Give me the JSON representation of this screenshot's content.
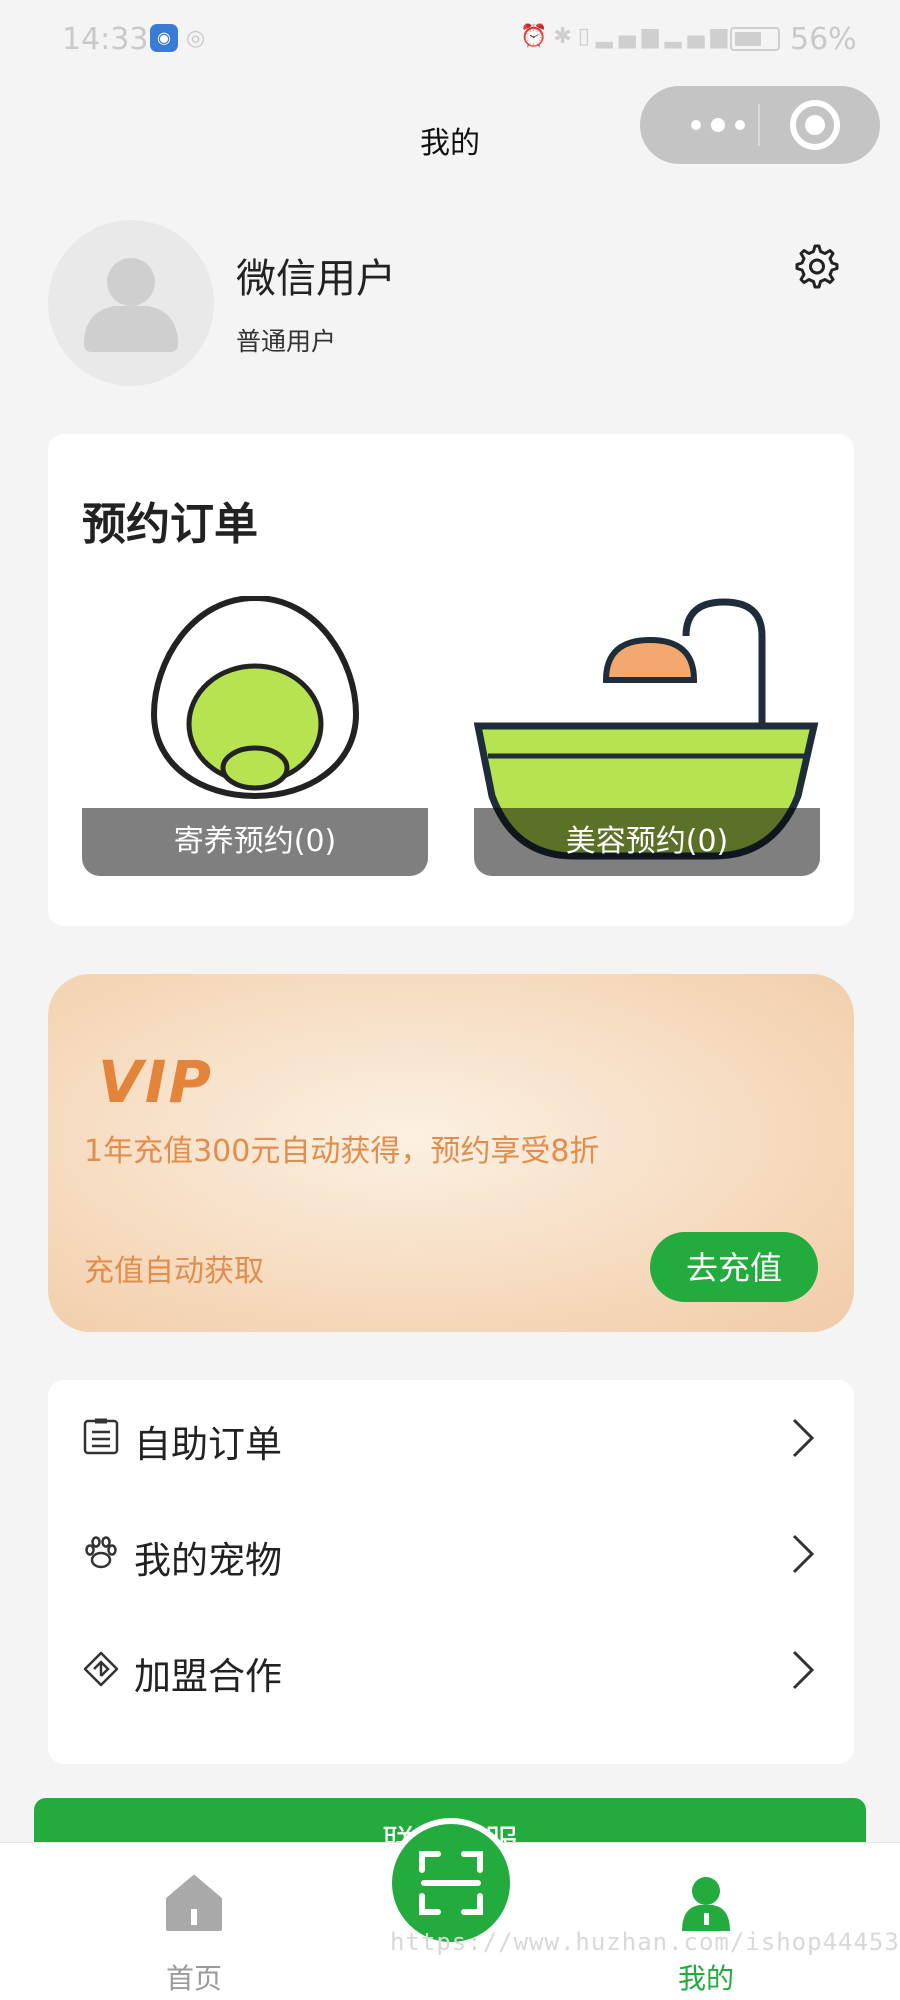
{
  "status_bar": {
    "time": "14:33",
    "battery": "56%"
  },
  "header": {
    "title": "我的"
  },
  "profile": {
    "name": "微信用户",
    "level": "普通用户"
  },
  "appointments": {
    "title": "预约订单",
    "items": [
      {
        "label": "寄养预约(0)",
        "icon": "egg-icon"
      },
      {
        "label": "美容预约(0)",
        "icon": "bathtub-icon"
      }
    ]
  },
  "vip": {
    "badge": "VIP",
    "description": "1年充值300元自动获得，预约享受8折",
    "note": "充值自动获取",
    "button": "去充值"
  },
  "menu": [
    {
      "label": "自助订单",
      "icon": "list-icon"
    },
    {
      "label": "我的宠物",
      "icon": "paw-icon"
    },
    {
      "label": "加盟合作",
      "icon": "handshake-icon"
    }
  ],
  "contact_button": "联系客服",
  "tabbar": {
    "tabs": [
      {
        "label": "首页",
        "icon": "home-icon"
      },
      {
        "label": "我的",
        "icon": "user-icon"
      }
    ],
    "scan_icon": "scan-icon"
  },
  "watermark": "https://www.huzhan.com/ishop44453",
  "colors": {
    "accent": "#23ab3e",
    "vip_text": "#e08d4d"
  }
}
